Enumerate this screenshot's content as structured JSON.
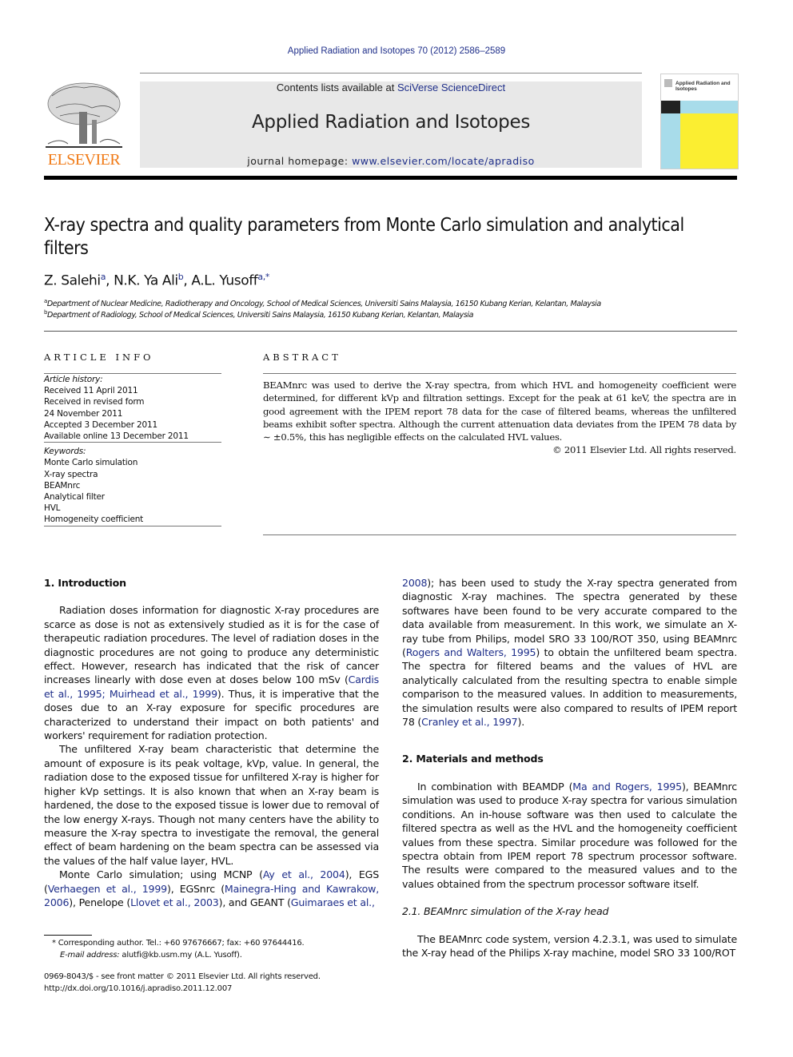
{
  "journal_ref": "Applied Radiation and Isotopes 70 (2012) 2586–2589",
  "masthead": {
    "publisher_logo_text": "ELSEVIER",
    "contents_prefix": "Contents lists available at ",
    "contents_link": "SciVerse ScienceDirect",
    "journal_title": "Applied Radiation and Isotopes",
    "homepage_prefix": "journal homepage: ",
    "homepage_link": "www.elsevier.com/locate/apradiso",
    "cover_title": "Applied Radiation and Isotopes",
    "colors": {
      "publisher_orange": "#f07a16",
      "link_blue": "#1f2f8a",
      "cover_blue": "#a8dcea",
      "cover_yellow": "#fbee31",
      "header_gray": "#e8e8e8"
    }
  },
  "article": {
    "title": "X-ray spectra and quality parameters from Monte Carlo simulation and analytical filters",
    "authors": [
      {
        "name": "Z. Salehi",
        "sup": "a"
      },
      {
        "name": "N.K. Ya Ali",
        "sup": "b"
      },
      {
        "name": "A.L. Yusoff",
        "sup": "a,*"
      }
    ],
    "affiliations": [
      {
        "sup": "a",
        "text": "Department of Nuclear Medicine, Radiotherapy and Oncology, School of Medical Sciences, Universiti Sains Malaysia, 16150 Kubang Kerian, Kelantan, Malaysia"
      },
      {
        "sup": "b",
        "text": "Department of Radiology, School of Medical Sciences, Universiti Sains Malaysia, 16150 Kubang Kerian, Kelantan, Malaysia"
      }
    ]
  },
  "article_info": {
    "heading": "ARTICLE INFO",
    "history_label": "Article history:",
    "history": [
      "Received 11 April 2011",
      "Received in revised form",
      "24 November 2011",
      "Accepted 3 December 2011",
      "Available online 13 December 2011"
    ],
    "keywords_label": "Keywords:",
    "keywords": [
      "Monte Carlo simulation",
      "X-ray spectra",
      "BEAMnrc",
      "Analytical filter",
      "HVL",
      "Homogeneity coefficient"
    ]
  },
  "abstract": {
    "heading": "ABSTRACT",
    "text": "BEAMnrc was used to derive the X-ray spectra, from which HVL and homogeneity coefficient were determined, for different kVp and filtration settings. Except for the peak at 61 keV, the spectra are in good agreement with the IPEM report 78 data for the case of filtered beams, whereas the unfiltered beams exhibit softer spectra. Although the current attenuation data deviates from the IPEM 78 data by ∼ ±0.5%, this has negligible effects on the calculated HVL values.",
    "copyright": "© 2011 Elsevier Ltd. All rights reserved."
  },
  "body": {
    "sec1_heading": "1.  Introduction",
    "p1_a": "Radiation doses information for diagnostic X-ray procedures are scarce as dose is not as extensively studied as it is for the case of therapeutic radiation procedures. The level of radiation doses in the diagnostic procedures are not going to produce any deterministic effect. However, research has indicated that the risk of cancer increases linearly with dose even at doses below 100 mSv (",
    "p1_cite": "Cardis et al., 1995; Muirhead et al., 1999",
    "p1_b": "). Thus, it is imperative that the doses due to an X-ray exposure for specific procedures are characterized to understand their impact on both patients' and workers' requirement for radiation protection.",
    "p2": "The unfiltered X-ray beam characteristic that determine the amount of exposure is its peak voltage, kVp, value. In general, the radiation dose to the exposed tissue for unfiltered X-ray is higher for higher kVp settings. It is also known that when an X-ray beam is hardened, the dose to the exposed tissue is lower due to removal of the low energy X-rays. Though not many centers have the ability to measure the X-ray spectra to investigate the removal, the general effect of beam hardening on the beam spectra can be assessed via the values of the half value layer, HVL.",
    "p3_a": "Monte Carlo simulation; using MCNP (",
    "p3_c1": "Ay et al., 2004",
    "p3_b": "), EGS (",
    "p3_c2": "Verhaegen et al., 1999",
    "p3_c": "), EGSnrc (",
    "p3_c3": "Mainegra-Hing and Kawrakow, 2006",
    "p3_d": "), Penelope (",
    "p3_c4": "Llovet et al., 2003",
    "p3_e": "), and GEANT (",
    "p3_c5": "Guimaraes et al., 2008",
    "p3_f": "); has been used to study the X-ray spectra generated from diagnostic X-ray machines. The spectra generated by these softwares have been found to be very accurate compared to the data available from measurement. In this work, we simulate an X-ray tube from Philips, model SRO 33 100/ROT 350, using BEAMnrc (",
    "p3_c6": "Rogers and Walters, 1995",
    "p3_g": ") to obtain the unfiltered beam spectra. The spectra for filtered beams and the values of HVL are analytically calculated from the resulting spectra to enable simple comparison to the measured values. In addition to measurements, the simulation results were also compared to results of IPEM report 78 (",
    "p3_c7": "Cranley et al., 1997",
    "p3_h": ").",
    "sec2_heading": "2.  Materials and methods",
    "p4_a": "In combination with BEAMDP (",
    "p4_cite": "Ma and Rogers, 1995",
    "p4_b": "), BEAMnrc simulation was used to produce X-ray spectra for various simulation conditions. An in-house software was then used to calculate the filtered spectra as well as the HVL and the homogeneity coefficient values from these spectra. Similar procedure was followed for the spectra obtain from IPEM report 78 spectrum processor software. The results were compared to the measured values and to the values obtained from the spectrum processor software itself.",
    "sec21_heading": "2.1.  BEAMnrc simulation of the X-ray head",
    "p5": "The BEAMnrc code system, version 4.2.3.1, was used to simulate the X-ray head of the Philips X-ray machine, model SRO 33 100/ROT"
  },
  "footnote": {
    "line1": "* Corresponding author. Tel.: +60 97676667; fax: +60 97644416.",
    "email_label": "E-mail address:",
    "email": " alutfi@kb.usm.my (A.L. Yusoff)."
  },
  "bottom": {
    "issn": "0969-8043/$ - see front matter © 2011 Elsevier Ltd. All rights reserved.",
    "doi": "http://dx.doi.org/10.1016/j.apradiso.2011.12.007"
  }
}
